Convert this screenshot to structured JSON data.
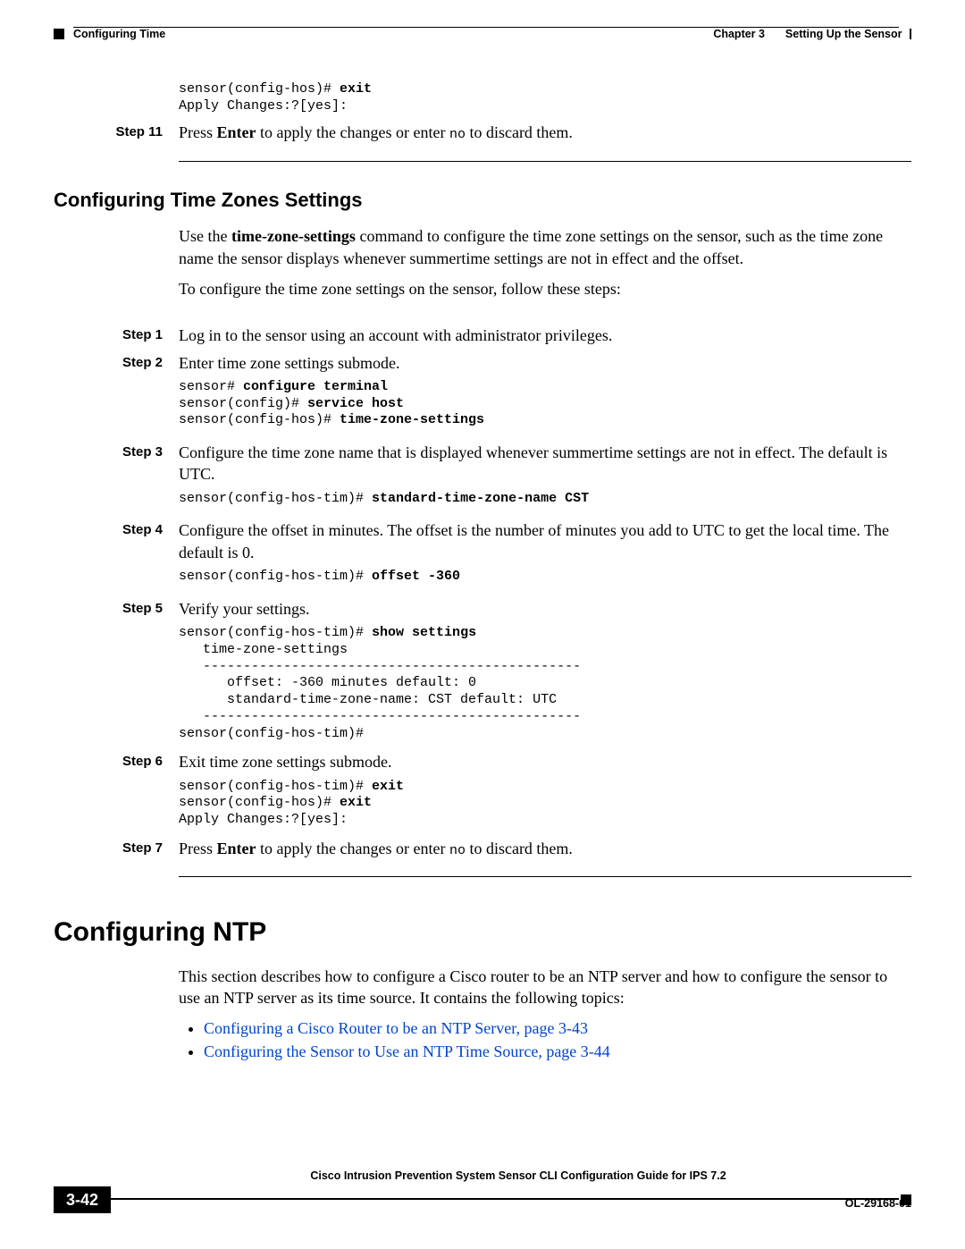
{
  "header": {
    "chapter_label": "Chapter 3",
    "chapter_title": "Setting Up the Sensor",
    "section_left": "Configuring Time"
  },
  "top_block": {
    "code_lines": [
      {
        "prompt": "sensor(config-hos)# ",
        "cmd": "exit"
      },
      {
        "prompt": "Apply Changes:?[yes]:",
        "cmd": ""
      }
    ],
    "step11": {
      "label": "Step 11",
      "text_before": "Press ",
      "bold1": "Enter",
      "text_mid": " to apply the changes or enter ",
      "mono1": "no",
      "text_after": " to discard them."
    }
  },
  "tz_section": {
    "heading": "Configuring Time Zones Settings",
    "para1_before": "Use the ",
    "para1_bold": "time-zone-settings",
    "para1_after": " command to configure the time zone settings on the sensor, such as the time zone name the sensor displays whenever summertime settings are not in effect and the offset.",
    "para2": "To configure the time zone settings on the sensor, follow these steps:",
    "steps": {
      "s1": {
        "label": "Step 1",
        "text": "Log in to the sensor using an account with administrator privileges."
      },
      "s2": {
        "label": "Step 2",
        "text": "Enter time zone settings submode.",
        "code": [
          {
            "prompt": "sensor# ",
            "cmd": "configure terminal"
          },
          {
            "prompt": "sensor(config)# ",
            "cmd": "service host"
          },
          {
            "prompt": "sensor(config-hos)# ",
            "cmd": "time-zone-settings"
          }
        ]
      },
      "s3": {
        "label": "Step 3",
        "text": "Configure the time zone name that is displayed whenever summertime settings are not in effect. The default is UTC.",
        "code": [
          {
            "prompt": "sensor(config-hos-tim)# ",
            "cmd": "standard-time-zone-name CST"
          }
        ]
      },
      "s4": {
        "label": "Step 4",
        "text": "Configure the offset in minutes. The offset is the number of minutes you add to UTC to get the local time. The default is 0.",
        "code": [
          {
            "prompt": "sensor(config-hos-tim)# ",
            "cmd": "offset -360"
          }
        ]
      },
      "s5": {
        "label": "Step 5",
        "text": "Verify your settings.",
        "code_plain": "sensor(config-hos-tim)# ",
        "code_bold": "show settings",
        "code_rest": "   time-zone-settings\n   -----------------------------------------------\n      offset: -360 minutes default: 0\n      standard-time-zone-name: CST default: UTC\n   -----------------------------------------------\nsensor(config-hos-tim)#"
      },
      "s6": {
        "label": "Step 6",
        "text": "Exit time zone settings submode.",
        "code": [
          {
            "prompt": "sensor(config-hos-tim)# ",
            "cmd": "exit"
          },
          {
            "prompt": "sensor(config-hos)# ",
            "cmd": "exit"
          },
          {
            "prompt": "Apply Changes:?[yes]:",
            "cmd": ""
          }
        ]
      },
      "s7": {
        "label": "Step 7",
        "text_before": "Press ",
        "bold1": "Enter",
        "text_mid": " to apply the changes or enter ",
        "mono1": "no",
        "text_after": " to discard them."
      }
    }
  },
  "ntp_section": {
    "heading": "Configuring NTP",
    "para": "This section describes how to configure a Cisco router to be an NTP server and how to configure the sensor to use an NTP server as its time source. It contains the following topics:",
    "links": {
      "l1": "Configuring a Cisco Router to be an NTP Server, page 3-43",
      "l2": "Configuring the Sensor to Use an NTP Time Source, page 3-44"
    }
  },
  "footer": {
    "book_title": "Cisco Intrusion Prevention System Sensor CLI Configuration Guide for IPS 7.2",
    "page_number": "3-42",
    "doc_number": "OL-29168-01"
  }
}
